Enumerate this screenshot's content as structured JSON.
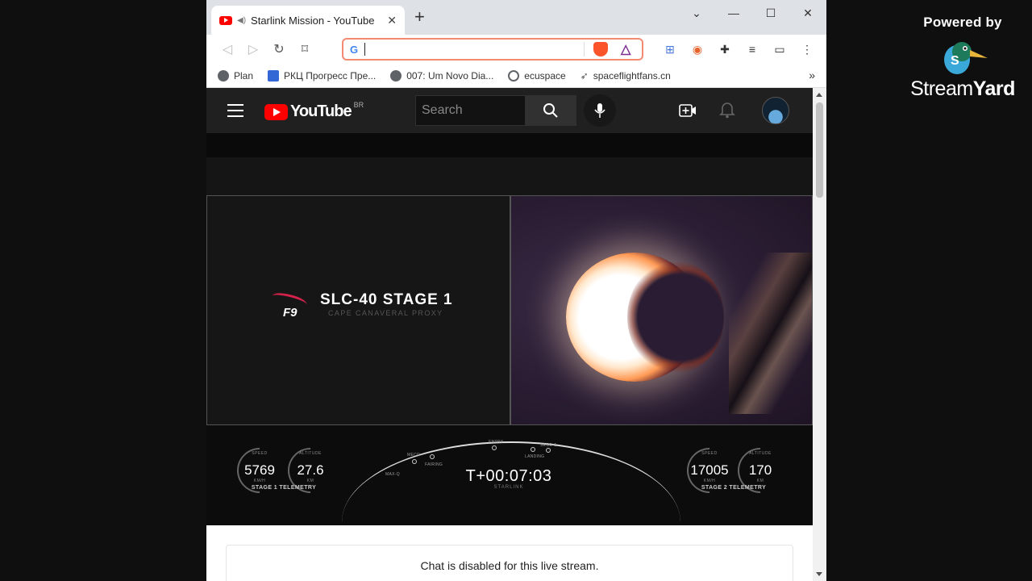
{
  "watermark": {
    "powered_by": "Powered by",
    "brand_stream": "Stream",
    "brand_yard": "Yard"
  },
  "browser": {
    "tab_title": "Starlink Mission - YouTube",
    "window_controls": [
      "minimize",
      "maximize",
      "close"
    ],
    "omnibox_value": "",
    "bookmarks": [
      {
        "label": "Plan",
        "icon": "globe-icon"
      },
      {
        "label": "РКЦ Прогресс Пре...",
        "icon": "rkc-icon"
      },
      {
        "label": "007: Um Novo Dia...",
        "icon": "globe-icon"
      },
      {
        "label": "ecuspace",
        "icon": "orbit-icon"
      },
      {
        "label": "spaceflightfans.cn",
        "icon": "rocket-icon"
      }
    ],
    "bookmarks_overflow": "»"
  },
  "youtube": {
    "logo_text": "YouTube",
    "country_code": "BR",
    "search_placeholder": "Search",
    "chat_disabled": "Chat is disabled for this live stream."
  },
  "stream": {
    "stage_title": "SLC-40 STAGE 1",
    "stage_subtitle": "CAPE CANAVERAL PROXY",
    "f9_label": "F9",
    "stage1": {
      "speed": "5769",
      "altitude": "27.6",
      "speed_label": "SPEED",
      "speed_unit": "KM/H",
      "altitude_label": "ALTITUDE",
      "altitude_unit": "KM",
      "telemetry_label": "STAGE 1 TELEMETRY"
    },
    "stage2": {
      "speed": "17005",
      "altitude": "170",
      "speed_label": "SPEED",
      "speed_unit": "KM/H",
      "altitude_label": "ALTITUDE",
      "altitude_unit": "KM",
      "telemetry_label": "STAGE 2 TELEMETRY"
    },
    "timer": "T+00:07:03",
    "mission": "STARLINK",
    "milestones": [
      "MAX-Q",
      "MECO",
      "FAIRING",
      "ENTRY",
      "LANDING",
      "SECO-1"
    ]
  }
}
